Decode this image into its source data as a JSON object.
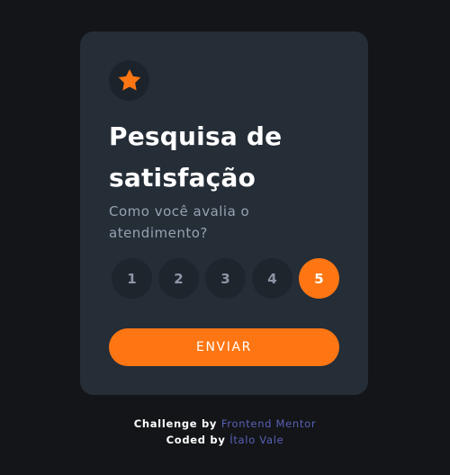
{
  "colors": {
    "background": "#131518",
    "card": "#252d37",
    "accent": "#fd7613",
    "muted_text": "#97a1b0",
    "rating_button": "#1f252d",
    "link": "#5b61b7"
  },
  "card": {
    "icon": "star-icon",
    "title": "Pesquisa de satisfação",
    "description": "Como você avalia o atendimento?",
    "selected_rating": 5,
    "ratings": [
      "1",
      "2",
      "3",
      "4",
      "5"
    ],
    "submit_label": "ENVIAR"
  },
  "attribution": {
    "challenge_prefix": "Challenge by",
    "challenge_link": "Frontend Mentor",
    "coded_prefix": "Coded by",
    "coded_link": "Ítalo Vale"
  }
}
